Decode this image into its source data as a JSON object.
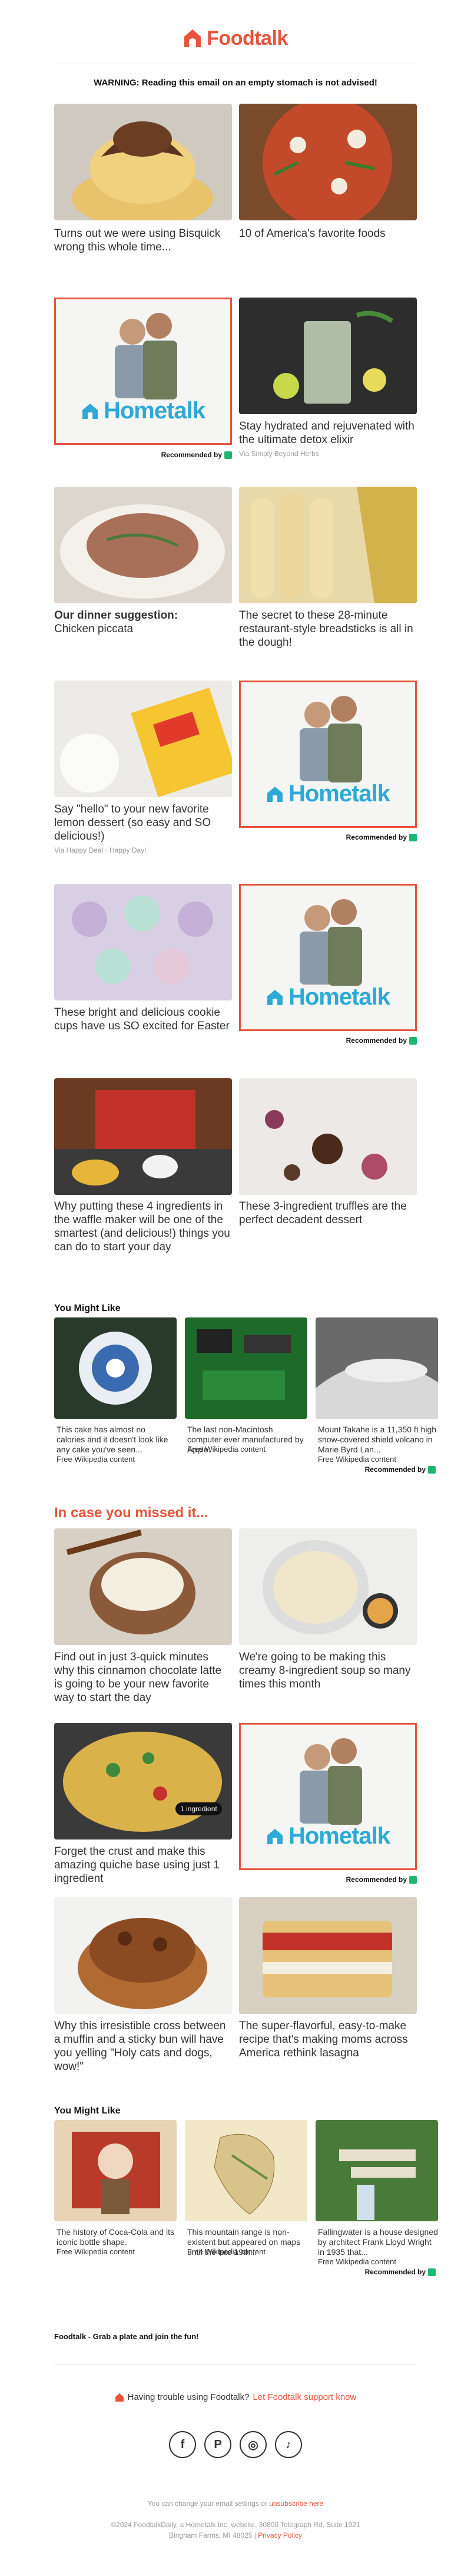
{
  "brand": {
    "name": "Foodtalk",
    "color": "#e8533b"
  },
  "warning": "WARNING: Reading this email on an empty stomach is not advised!",
  "recommended_label": "Recommended by",
  "ad_brand": "Hometalk",
  "cards": {
    "c1": "Turns out we were using Bisquick wrong this whole time...",
    "c2": "10 of America's favorite foods",
    "c4": "Stay hydrated and rejuvenated with the ultimate detox elixir",
    "c4_src": "Via Simply Beyond Herbs",
    "c5_bold": "Our dinner suggestion:",
    "c5": "Chicken piccata",
    "c6": "The secret to these 28-minute restaurant-style breadsticks is all in the dough!",
    "c7": "Say \"hello\" to your new favorite lemon dessert (so easy and SO delicious!)",
    "c7_src": "Via Happy Deal - Happy Day!",
    "c9": "These bright and delicious cookie cups have us SO excited for Easter",
    "c11": "Why putting these 4 ingredients in the waffle maker will be one of the smartest (and delicious!) things you can do to start your day",
    "c12": "These 3-ingredient truffles are the perfect decadent dessert"
  },
  "you_might_like_1": {
    "heading": "You Might Like",
    "items": [
      {
        "text": "This cake has almost no calories and it doesn't look like any cake you've seen...",
        "src": "Free Wikipedia content"
      },
      {
        "text": "The last non-Macintosh computer ever manufactured by Apple.",
        "src": "Free Wikipedia content"
      },
      {
        "text": "Mount Takahe is a 11,350 ft high snow-covered shield volcano in Marie Byrd Lan...",
        "src": "Free Wikipedia content"
      }
    ]
  },
  "in_case": {
    "heading": "In case you missed it...",
    "i1": "Find out in just 3-quick minutes why this cinnamon chocolate latte is going to be your new favorite way to start the day",
    "i2": "We're going to be making this creamy 8-ingredient soup so many times this month",
    "i3": "Forget the crust and make this amazing quiche base using just 1 ingredient",
    "i3_badge": "1 ingredient",
    "i5": "Why this irresistible cross between a muffin and a sticky bun will have you yelling \"Holy cats and dogs, wow!\"",
    "i6": "The super-flavorful, easy-to-make recipe that's making moms across America rethink lasagna"
  },
  "you_might_like_2": {
    "heading": "You Might Like",
    "items": [
      {
        "text": "The history of Coca-Cola and its iconic bottle shape.",
        "src": "Free Wikipedia content"
      },
      {
        "text": "This mountain range is non-existent but appeared on maps until the late 19th...",
        "src": "Free Wikipedia content"
      },
      {
        "text": "Fallingwater is a house designed by architect Frank Lloyd Wright in 1935 that...",
        "src": "Free Wikipedia content"
      }
    ]
  },
  "tagline": "Foodtalk - Grab a plate and join the fun!",
  "support": {
    "prefix": "Having trouble using Foodtalk?",
    "link": "Let Foodtalk support know"
  },
  "social": [
    "f",
    "P",
    "◎",
    "♪"
  ],
  "settings": {
    "prefix": "You can change your email settings or",
    "link": "unsubscribe here"
  },
  "legal": "©2024 FoodtalkDaily, a Hometalk Inc. website, 30800 Telegraph Rd, Suite 1921",
  "legal2": "Bingham Farms, MI 48025",
  "privacy": "Privacy Policy"
}
